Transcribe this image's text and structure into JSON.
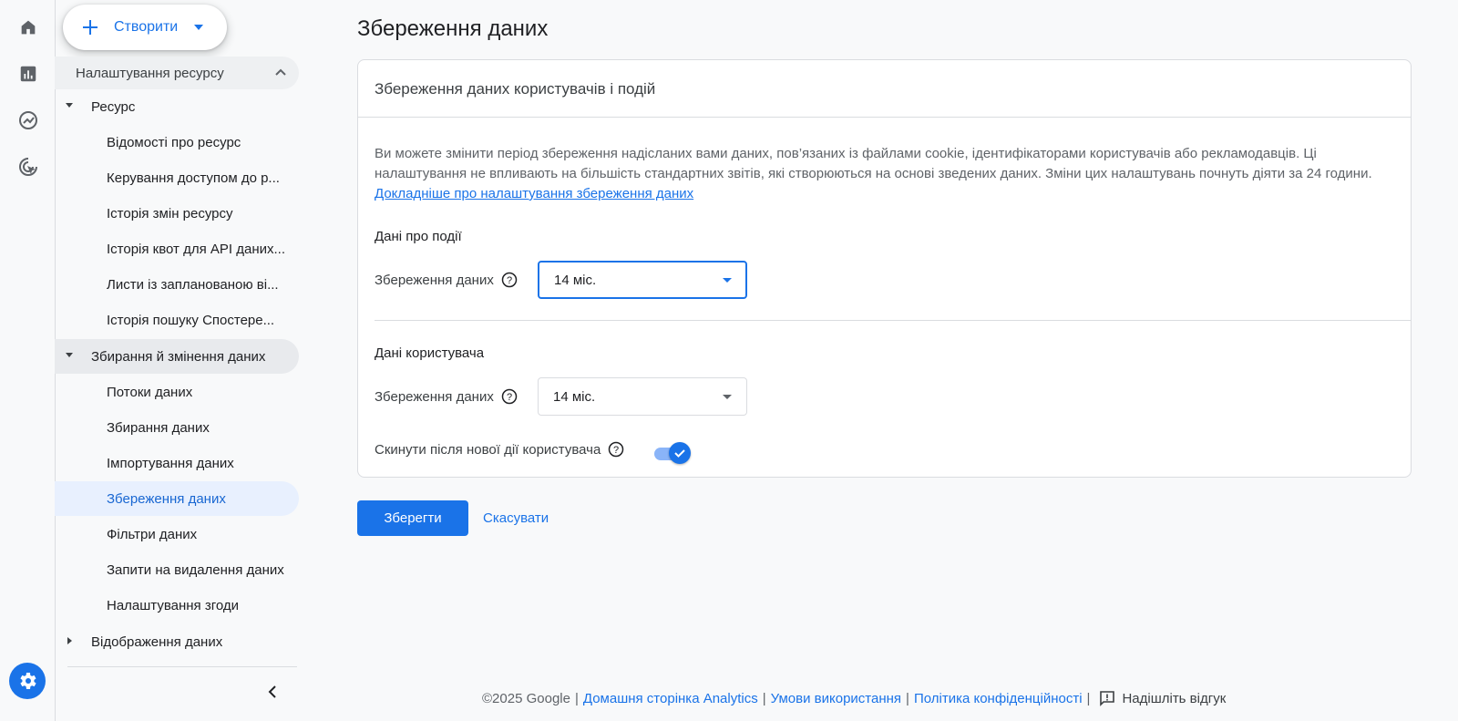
{
  "create_button": {
    "label": "Створити"
  },
  "nav": {
    "header": "Налаштування ресурсу",
    "groups": [
      {
        "label": "Ресурс",
        "items": [
          "Відомості про ресурс",
          "Керування доступом до р...",
          "Історія змін ресурсу",
          "Історія квот для API даних...",
          "Листи із запланованою ві...",
          "Історія пошуку Спостере..."
        ]
      },
      {
        "label": "Збирання й змінення даних",
        "items": [
          "Потоки даних",
          "Збирання даних",
          "Імпортування даних",
          "Збереження даних",
          "Фільтри даних",
          "Запити на видалення даних",
          "Налаштування згоди"
        ]
      },
      {
        "label": "Відображення даних",
        "items": []
      }
    ]
  },
  "page": {
    "title": "Збереження даних",
    "card_title": "Збереження даних користувачів і подій",
    "description": "Ви можете змінити період збереження надісланих вами даних, пов’язаних із файлами cookie, ідентифікаторами користувачів або рекламодавців. Ці налаштування не впливають на більшість стандартних звітів, які створюються на основі зведених даних. Зміни цих налаштувань почнуть діяти за 24 години. ",
    "learn_more_link": "Докладніше про налаштування збереження даних",
    "event_section": "Дані про події",
    "event_retention_label": "Збереження даних",
    "event_retention_value": "14 міс.",
    "user_section": "Дані користувача",
    "user_retention_label": "Збереження даних",
    "user_retention_value": "14 міс.",
    "reset_label": "Скинути після нової дії користувача",
    "reset_enabled": true
  },
  "actions": {
    "save": "Зберегти",
    "cancel": "Скасувати"
  },
  "footer": {
    "copyright": "©2025 Google",
    "links": [
      "Домашня сторінка Analytics",
      "Умови використання",
      "Політика конфіденційності"
    ],
    "feedback": "Надішліть відгук"
  },
  "colors": {
    "accent": "#1a73e8",
    "selected_bg": "#e8f0fe"
  }
}
